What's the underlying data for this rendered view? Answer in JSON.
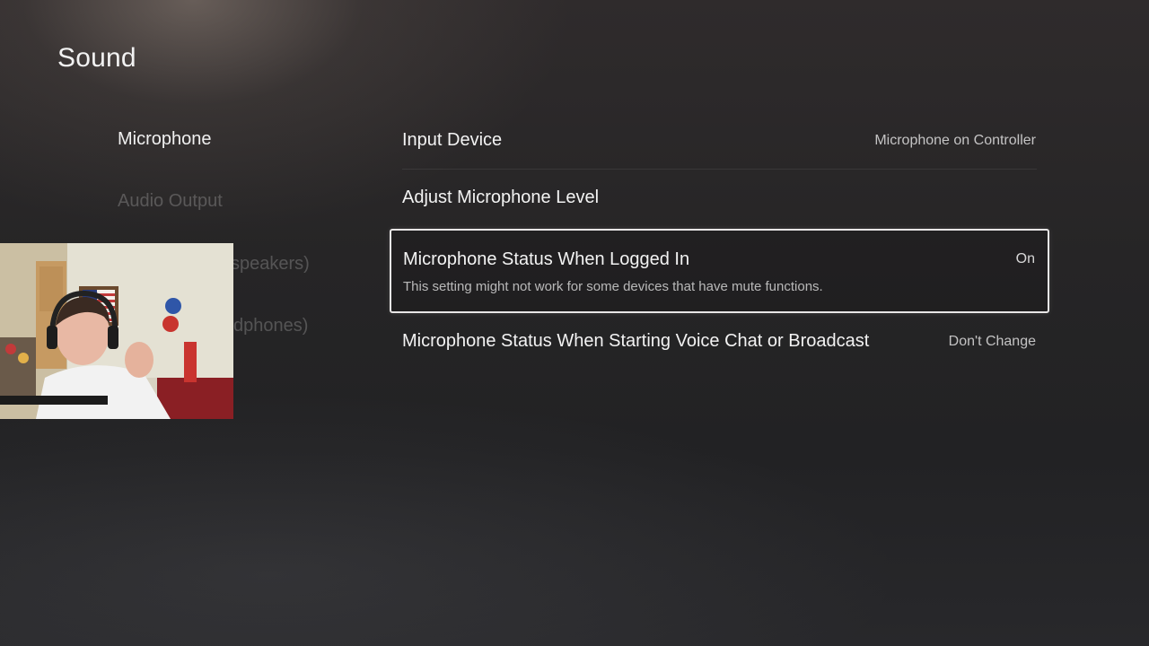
{
  "page": {
    "title": "Sound"
  },
  "sidebar": {
    "items": [
      {
        "label": "Microphone",
        "state": "selected"
      },
      {
        "label": "Audio Output",
        "state": "dim"
      },
      {
        "label": "speakers)",
        "state": "dim-partially-hidden"
      },
      {
        "label": "dphones)",
        "state": "dim-partially-hidden"
      }
    ]
  },
  "settings": {
    "rows": [
      {
        "label": "Input Device",
        "value": "Microphone on Controller"
      },
      {
        "label": "Adjust Microphone Level"
      },
      {
        "label": "Microphone Status When Logged In",
        "value": "On",
        "description": "This setting might not work for some devices that have mute functions.",
        "focused": true
      },
      {
        "label": "Microphone Status When Starting Voice Chat or Broadcast",
        "value": "Don't Change"
      }
    ]
  },
  "colors": {
    "focus_border": "#e8e6e6",
    "text_primary": "#f3f3f3",
    "background": "#262526"
  }
}
